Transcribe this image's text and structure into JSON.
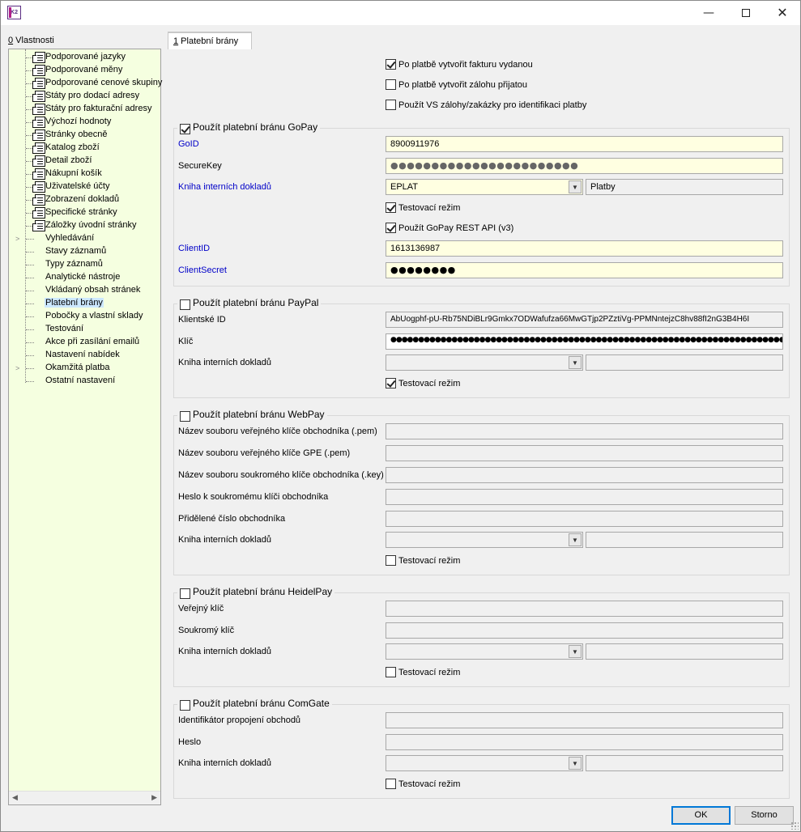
{
  "window": {
    "logo_text": "K2",
    "minimize": "—",
    "close": "✕"
  },
  "tabs": {
    "left": {
      "hotkey": "0",
      "label": " Vlastnosti"
    },
    "right": {
      "hotkey": "1",
      "label": " Platební brány"
    }
  },
  "tree": {
    "items": [
      {
        "label": "Podporované jazyky",
        "expandable": false,
        "selected": false
      },
      {
        "label": "Podporované měny",
        "expandable": false,
        "selected": false
      },
      {
        "label": "Podporované cenové skupiny",
        "expandable": false,
        "selected": false
      },
      {
        "label": "Státy pro dodací adresy",
        "expandable": false,
        "selected": false
      },
      {
        "label": "Státy pro fakturační adresy",
        "expandable": false,
        "selected": false
      },
      {
        "label": "Výchozí hodnoty",
        "expandable": false,
        "selected": false
      },
      {
        "label": "Stránky obecně",
        "expandable": false,
        "selected": false
      },
      {
        "label": "Katalog zboží",
        "expandable": false,
        "selected": false
      },
      {
        "label": "Detail zboží",
        "expandable": false,
        "selected": false
      },
      {
        "label": "Nákupní košík",
        "expandable": false,
        "selected": false
      },
      {
        "label": "Uživatelské účty",
        "expandable": false,
        "selected": false
      },
      {
        "label": "Zobrazení dokladů",
        "expandable": false,
        "selected": false
      },
      {
        "label": "Specifické stránky",
        "expandable": false,
        "selected": false
      },
      {
        "label": "Záložky úvodní stránky",
        "expandable": false,
        "selected": false
      },
      {
        "label": "Vyhledávání",
        "expandable": true,
        "selected": false
      },
      {
        "label": "Stavy záznamů",
        "expandable": false,
        "selected": false
      },
      {
        "label": "Typy záznamů",
        "expandable": false,
        "selected": false
      },
      {
        "label": "Analytické nástroje",
        "expandable": false,
        "selected": false
      },
      {
        "label": "Vkládaný obsah stránek",
        "expandable": false,
        "selected": false
      },
      {
        "label": "Platební brány",
        "expandable": false,
        "selected": true
      },
      {
        "label": "Pobočky a vlastní sklady",
        "expandable": false,
        "selected": false
      },
      {
        "label": "Testování",
        "expandable": false,
        "selected": false
      },
      {
        "label": "Akce při zasílání emailů",
        "expandable": false,
        "selected": false
      },
      {
        "label": "Nastavení nabídek",
        "expandable": false,
        "selected": false
      },
      {
        "label": "Okamžitá platba",
        "expandable": true,
        "selected": false
      },
      {
        "label": "Ostatní nastavení",
        "expandable": false,
        "selected": false
      }
    ],
    "scroll_left": "◀",
    "scroll_right": "▶"
  },
  "general": {
    "create_invoice": {
      "label": "Po platbě vytvořit fakturu vydanou",
      "checked": true
    },
    "create_deposit": {
      "label": "Po platbě vytvořit zálohu přijatou",
      "checked": false
    },
    "use_vs": {
      "label": "Použít VS zálohy/zakázky pro identifikaci platby",
      "checked": false
    }
  },
  "gopay": {
    "title": "Použít platební bránu GoPay",
    "enabled": true,
    "goid_label": "GoID",
    "goid_value": "8900911976",
    "securekey_label": "SecureKey",
    "securekey_value": "●●●●●●●●●●●●●●●●●●●●●●●",
    "book_label": "Kniha interních dokladů",
    "book_value": "EPLAT",
    "book_name": "Platby",
    "test_mode": {
      "label": "Testovací režim",
      "checked": true
    },
    "rest_api": {
      "label": "Použít GoPay REST API (v3)",
      "checked": true
    },
    "clientid_label": "ClientID",
    "clientid_value": "1613136987",
    "clientsecret_label": "ClientSecret",
    "clientsecret_value": "●●●●●●●●"
  },
  "paypal": {
    "title": "Použít platební bránu PayPal",
    "enabled": false,
    "client_id_label": "Klientské ID",
    "client_id_value": "AbUogphf-pU-Rb75NDiBLr9Gmkx7ODWafufza66MwGTjp2PZztiVg-PPMNntejzC8hv88fI2nG3B4H6I",
    "key_label": "Klíč",
    "key_value": "●●●●●●●●●●●●●●●●●●●●●●●●●●●●●●●●●●●●●●●●●●●●●●●●●●●●●●●●●●●●●●●●●●●●●●●●●●●●●●",
    "book_label": "Kniha interních dokladů",
    "test_mode": {
      "label": "Testovací režim",
      "checked": true
    }
  },
  "webpay": {
    "title": "Použít platební bránu WebPay",
    "enabled": false,
    "public_key_label": "Název souboru veřejného klíče obchodníka (.pem)",
    "gpe_key_label": "Název souboru veřejného klíče GPE (.pem)",
    "private_key_label": "Název souboru soukromého klíče obchodníka (.key)",
    "private_pass_label": "Heslo k soukromému klíči obchodníka",
    "merchant_no_label": "Přidělené číslo obchodníka",
    "book_label": "Kniha interních dokladů",
    "test_mode": {
      "label": "Testovací režim",
      "checked": false
    }
  },
  "heidelpay": {
    "title": "Použít platební bránu HeidelPay",
    "enabled": false,
    "public_key_label": "Veřejný klíč",
    "private_key_label": "Soukromý klíč",
    "book_label": "Kniha interních dokladů",
    "test_mode": {
      "label": "Testovací režim",
      "checked": false
    }
  },
  "comgate": {
    "title": "Použít platební bránu ComGate",
    "enabled": false,
    "shop_id_label": "Identifikátor propojení obchodů",
    "password_label": "Heslo",
    "book_label": "Kniha interních dokladů",
    "test_mode": {
      "label": "Testovací režim",
      "checked": false
    }
  },
  "buttons": {
    "ok": "OK",
    "cancel": "Storno"
  }
}
